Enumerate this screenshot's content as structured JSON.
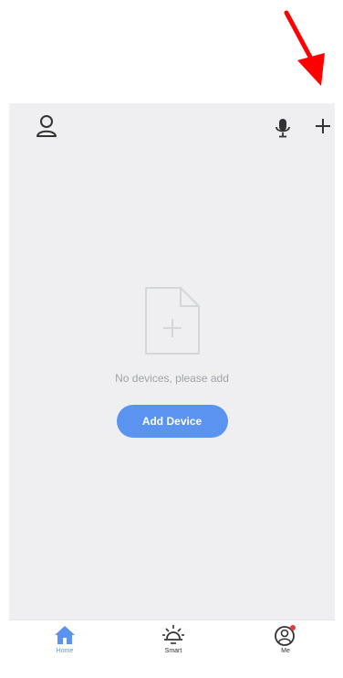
{
  "colors": {
    "accent": "#5a93f0",
    "background": "#efeff1",
    "icon": "#333333",
    "muted": "#9fa3ab",
    "badge": "#e8393a",
    "annotation_arrow": "#ff0000"
  },
  "header": {
    "left_icon": "user-icon",
    "right_icons": [
      "microphone-icon",
      "plus-icon"
    ]
  },
  "empty_state": {
    "icon": "document-add-icon",
    "message": "No devices, please add",
    "button_label": "Add Device"
  },
  "tabs": [
    {
      "label": "Home",
      "icon": "home-icon",
      "active": true
    },
    {
      "label": "Smart",
      "icon": "sun-icon",
      "active": false
    },
    {
      "label": "Me",
      "icon": "profile-icon",
      "active": false,
      "badge": true
    }
  ]
}
